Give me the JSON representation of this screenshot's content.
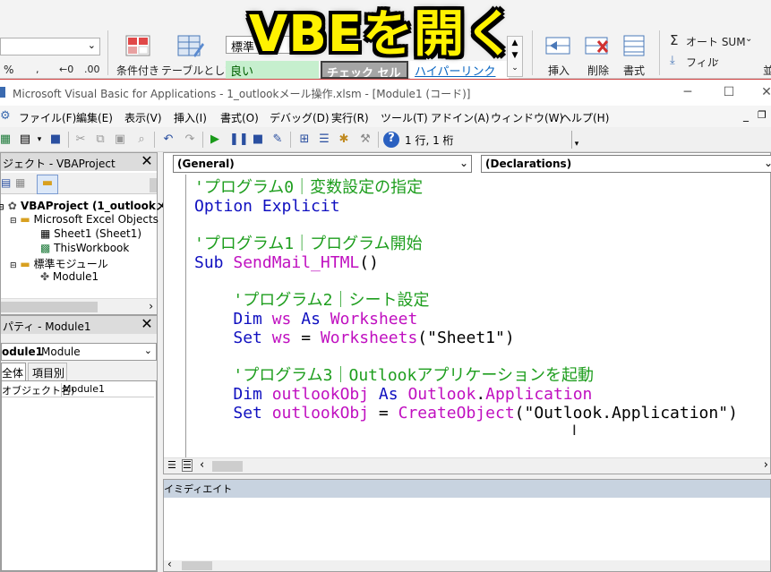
{
  "overlay_title": "VBEを開く",
  "ribbon": {
    "style_normal": "標準",
    "style_good": "良い",
    "style_check": "チェック セル",
    "style_hyperlink": "ハイパーリンク",
    "conditional_format": "条件付き",
    "format_as_table": "テーブルとして",
    "insert": "挿入",
    "delete": "削除",
    "format": "書式",
    "autosum": "オート SUM",
    "fill": "フィル",
    "number_fmt": "%"
  },
  "window": {
    "title": "Microsoft Visual Basic for Applications - 1_outlookメール操作.xlsm - [Module1 (コード)]"
  },
  "menu": [
    "ファイル(F)",
    "編集(E)",
    "表示(V)",
    "挿入(I)",
    "書式(O)",
    "デバッグ(D)",
    "実行(R)",
    "ツール(T)",
    "アドイン(A)",
    "ウィンドウ(W)",
    "ヘルプ(H)"
  ],
  "toolbar": {
    "position": "1 行, 1 桁"
  },
  "project": {
    "title": "ジェクト - VBAProject",
    "root": "VBAProject (1_outlookメ",
    "excel_objects": "Microsoft Excel Objects",
    "sheet1": "Sheet1 (Sheet1)",
    "thisworkbook": "ThisWorkbook",
    "std_modules": "標準モジュール",
    "module1": "Module1"
  },
  "properties": {
    "title": "パティ - Module1",
    "object_name": "odule1",
    "object_type": "Module",
    "tab_all": "全体",
    "tab_category": "項目別",
    "prop_name": "オブジェクト名)",
    "prop_value": "Module1"
  },
  "code": {
    "object_combo": "(General)",
    "proc_combo": "(Declarations)",
    "lines": [
      [
        [
          "cm",
          "'プログラム0｜変数設定の指定"
        ]
      ],
      [
        [
          "kw",
          "Option Explicit"
        ]
      ],
      [
        [
          "pl",
          ""
        ]
      ],
      [
        [
          "cm",
          "'プログラム1｜プログラム開始"
        ]
      ],
      [
        [
          "kw",
          "Sub "
        ],
        [
          "id",
          "SendMail_HTML"
        ],
        [
          "pl",
          "()"
        ]
      ],
      [
        [
          "pl",
          ""
        ]
      ],
      [
        [
          "pl",
          "    "
        ],
        [
          "cm",
          "'プログラム2｜シート設定"
        ]
      ],
      [
        [
          "pl",
          "    "
        ],
        [
          "kw",
          "Dim "
        ],
        [
          "id",
          "ws"
        ],
        [
          "kw",
          " As "
        ],
        [
          "id",
          "Worksheet"
        ]
      ],
      [
        [
          "pl",
          "    "
        ],
        [
          "kw",
          "Set "
        ],
        [
          "id",
          "ws"
        ],
        [
          "pl",
          " = "
        ],
        [
          "id",
          "Worksheets"
        ],
        [
          "pl",
          "(\"Sheet1\")"
        ]
      ],
      [
        [
          "pl",
          ""
        ]
      ],
      [
        [
          "pl",
          "    "
        ],
        [
          "cm",
          "'プログラム3｜Outlookアプリケーションを起動"
        ]
      ],
      [
        [
          "pl",
          "    "
        ],
        [
          "kw",
          "Dim "
        ],
        [
          "id",
          "outlookObj"
        ],
        [
          "kw",
          " As "
        ],
        [
          "id",
          "Outlook"
        ],
        [
          "pl",
          "."
        ],
        [
          "id",
          "Application"
        ]
      ],
      [
        [
          "pl",
          "    "
        ],
        [
          "kw",
          "Set "
        ],
        [
          "id",
          "outlookObj"
        ],
        [
          "pl",
          " = "
        ],
        [
          "id",
          "CreateObject"
        ],
        [
          "pl",
          "(\"Outlook.Application\")"
        ]
      ]
    ]
  },
  "immediate": {
    "title": "イミディエイト"
  },
  "colors": {
    "comment": "#1e9e1e",
    "keyword": "#1010c0",
    "identifier": "#c010c0",
    "overlay_text": "#fff200"
  }
}
